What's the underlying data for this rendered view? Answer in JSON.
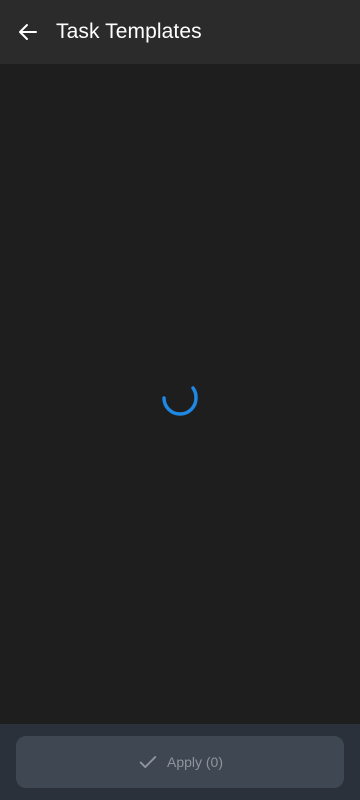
{
  "header": {
    "title": "Task Templates",
    "back_icon": "arrow-left-icon"
  },
  "main": {
    "state": "loading",
    "spinner_icon": "loading-spinner-icon",
    "accent_color": "#1e88e5"
  },
  "footer": {
    "apply_label": "Apply (0)",
    "apply_icon": "check-icon",
    "apply_enabled": false
  }
}
